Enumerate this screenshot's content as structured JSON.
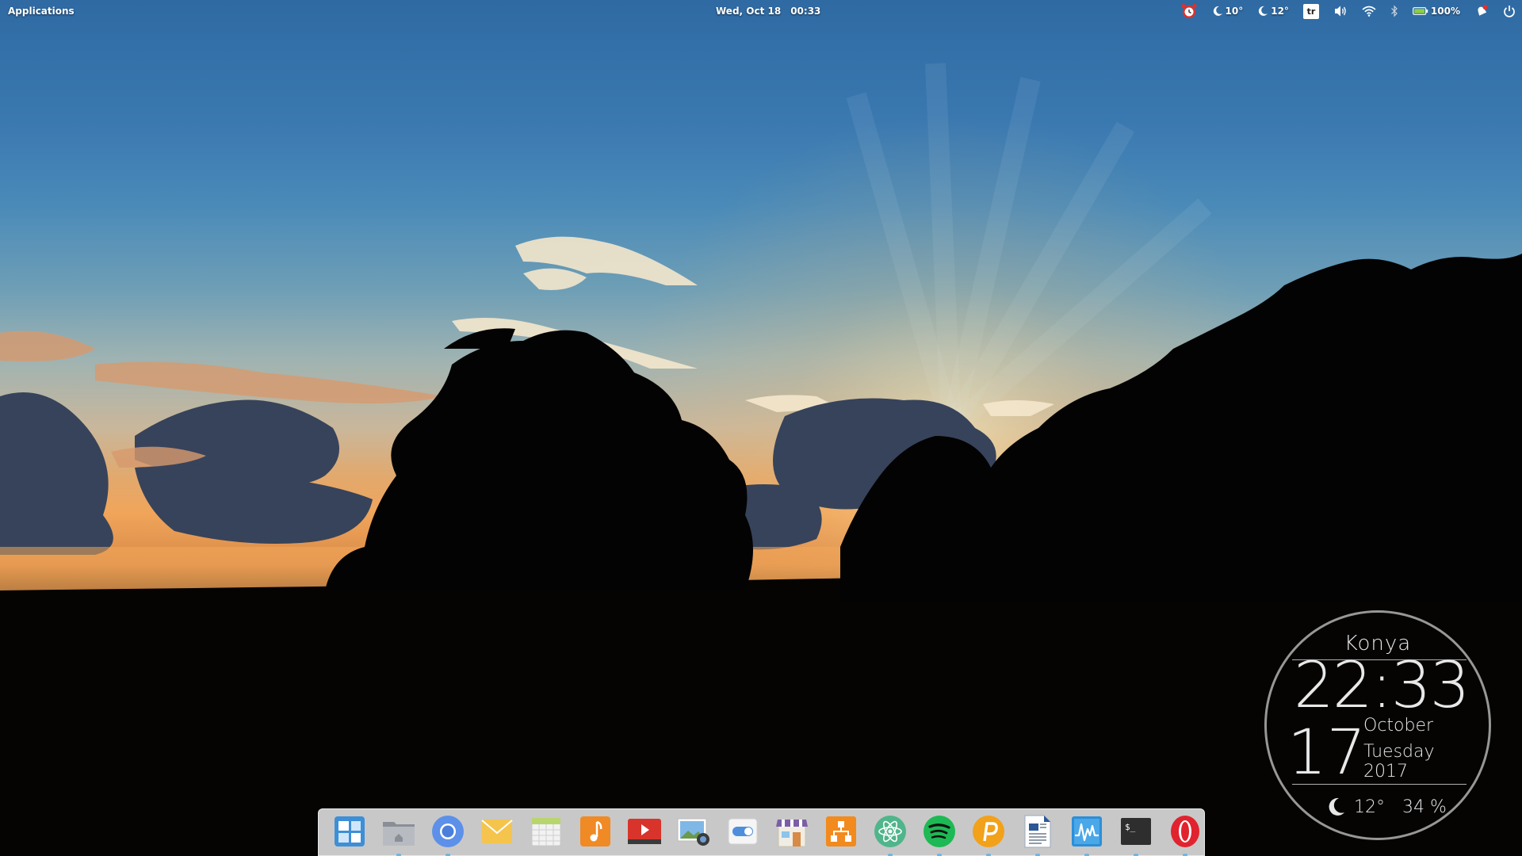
{
  "panel": {
    "applications_label": "Applications",
    "date": "Wed, Oct 18",
    "time": "00:33",
    "indicators": {
      "alarm_icon": "alarm-clock-icon",
      "weather1_temp": "10°",
      "weather2_temp": "12°",
      "keyboard_layout": "tr",
      "volume_icon": "volume-icon",
      "wifi_icon": "wifi-icon",
      "bluetooth_icon": "bluetooth-icon",
      "battery_percent": "100%",
      "notifications_icon": "notifications-icon",
      "power_icon": "power-icon"
    }
  },
  "widget": {
    "city": "Konya",
    "time": "22:33",
    "day": "17",
    "month": "October",
    "weekday": "Tuesday",
    "year": "2017",
    "temperature": "12°",
    "humidity": "34 %"
  },
  "dock": {
    "items": [
      {
        "name": "multitasking-view",
        "icon": "multitasking-icon",
        "running": false
      },
      {
        "name": "files",
        "icon": "files-icon",
        "running": true
      },
      {
        "name": "chromium",
        "icon": "chromium-icon",
        "running": true
      },
      {
        "name": "mail",
        "icon": "mail-icon",
        "running": false
      },
      {
        "name": "calendar",
        "icon": "calendar-icon",
        "running": false
      },
      {
        "name": "music",
        "icon": "music-icon",
        "running": false
      },
      {
        "name": "videos",
        "icon": "videos-icon",
        "running": false
      },
      {
        "name": "photos",
        "icon": "photos-icon",
        "running": false
      },
      {
        "name": "settings",
        "icon": "settings-toggle-icon",
        "running": false
      },
      {
        "name": "appcenter",
        "icon": "appcenter-icon",
        "running": false
      },
      {
        "name": "network-app",
        "icon": "orange-network-icon",
        "running": false
      },
      {
        "name": "atom",
        "icon": "atom-icon",
        "running": true
      },
      {
        "name": "spotify",
        "icon": "spotify-icon",
        "running": true
      },
      {
        "name": "pushbullet",
        "icon": "pushbullet-icon",
        "running": true
      },
      {
        "name": "text-document",
        "icon": "document-icon",
        "running": true
      },
      {
        "name": "system-monitor",
        "icon": "system-monitor-icon",
        "running": true
      },
      {
        "name": "terminal",
        "icon": "terminal-icon",
        "running": true
      },
      {
        "name": "opera",
        "icon": "opera-icon",
        "running": true
      }
    ]
  },
  "colors": {
    "dock_running_indicator": "#6cb7e6",
    "battery_green": "#8bd13f",
    "alarm_red": "#e0312b"
  }
}
